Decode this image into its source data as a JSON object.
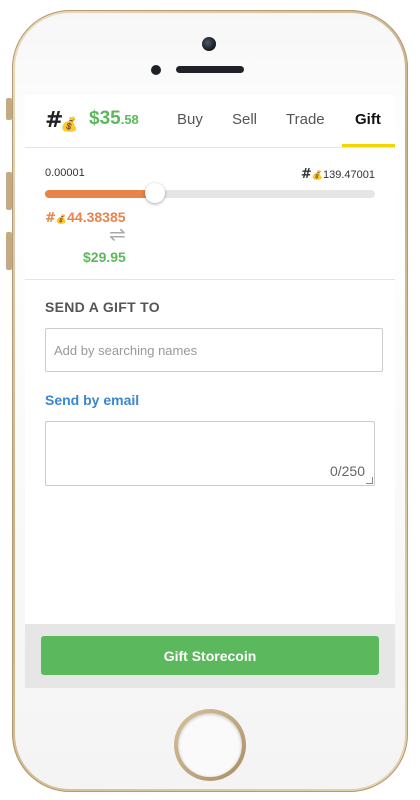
{
  "header": {
    "brand_symbol": "#",
    "brand_icon": "money-bag-icon",
    "balance_int": "$35",
    "balance_dec": ".58",
    "tabs": [
      {
        "label": "Buy"
      },
      {
        "label": "Sell"
      },
      {
        "label": "Trade"
      },
      {
        "label": "Gift",
        "active": true
      }
    ]
  },
  "slider": {
    "min_label": "0.00001",
    "max_symbol": "#",
    "max_value": "139.47001",
    "position_fraction": 0.333,
    "coin_symbol": "#",
    "coin_amount": "44.38385",
    "swap_icon": "swap-arrows-icon",
    "usd_amount": "$29.95"
  },
  "gift": {
    "title": "SEND A GIFT TO",
    "search_placeholder": "Add by searching names",
    "email_link": "Send by email",
    "message_counter": "0/250",
    "button_label": "Gift Storecoin"
  },
  "colors": {
    "accent_green": "#5cb85c",
    "accent_orange": "#e8834c",
    "tab_underline": "#f2d600",
    "link_blue": "#3a85d4"
  }
}
